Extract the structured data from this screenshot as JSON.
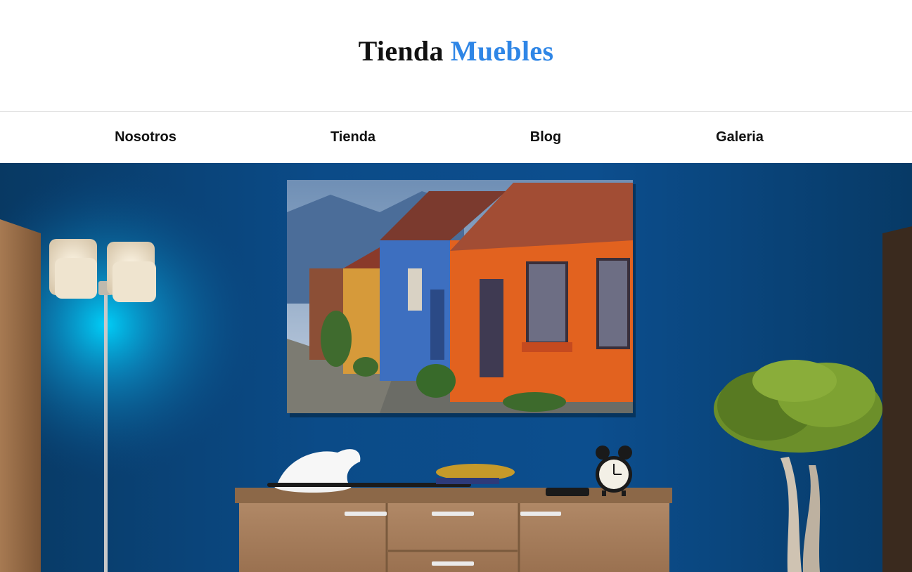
{
  "site": {
    "brand_part1": "Tienda",
    "brand_part2": "Muebles",
    "brand_colors": {
      "primary": "#111111",
      "accent": "#2f86e6"
    }
  },
  "nav": {
    "items": [
      {
        "label": "Nosotros"
      },
      {
        "label": "Tienda"
      },
      {
        "label": "Blog"
      },
      {
        "label": "Galeria"
      }
    ]
  },
  "hero": {
    "wall_color": "#0b4a86",
    "icons": [
      "floor-lamp-icon",
      "framed-painting-icon",
      "sideboard-icon",
      "alarm-clock-icon",
      "panther-figurine-icon",
      "sword-icon",
      "bonsai-tree-icon"
    ]
  }
}
